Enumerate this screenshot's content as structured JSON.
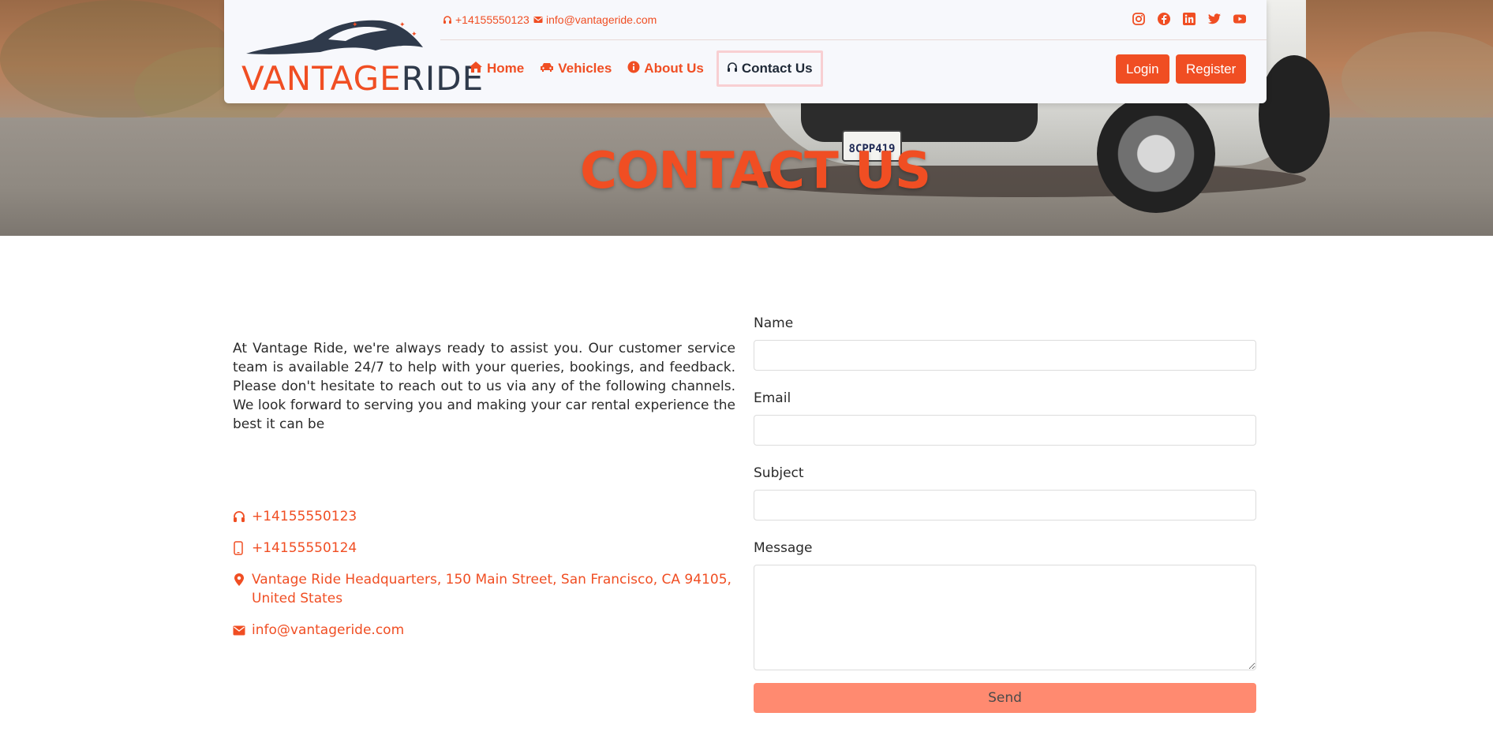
{
  "brand": {
    "part1": "VANTAGE",
    "part2": "RIDE"
  },
  "topbar": {
    "phone": "+14155550123",
    "email": "info@vantageride.com",
    "socials": [
      "instagram-icon",
      "facebook-icon",
      "linkedin-icon",
      "twitter-icon",
      "youtube-icon"
    ]
  },
  "nav": {
    "items": [
      {
        "label": "Home",
        "icon": "home-icon"
      },
      {
        "label": "Vehicles",
        "icon": "car-icon"
      },
      {
        "label": "About Us",
        "icon": "info-icon"
      },
      {
        "label": "Contact Us",
        "icon": "headset-icon",
        "active": true
      }
    ],
    "login": "Login",
    "register": "Register"
  },
  "hero": {
    "title": "CONTACT US",
    "plate": "8CPP419"
  },
  "intro": "At Vantage Ride, we're always ready to assist you. Our customer service team is available 24/7 to help with your queries, bookings, and feedback. Please don't hesitate to reach out to us via any of the following channels. We look forward to serving you and making your car rental experience the best it can be",
  "contacts": [
    {
      "icon": "headset-icon",
      "text": "+14155550123"
    },
    {
      "icon": "mobile-icon",
      "text": "+14155550124"
    },
    {
      "icon": "location-icon",
      "text": "Vantage Ride Headquarters, 150 Main Street, San Francisco, CA 94105, United States"
    },
    {
      "icon": "mail-icon",
      "text": "info@vantageride.com"
    }
  ],
  "form": {
    "name_label": "Name",
    "email_label": "Email",
    "subject_label": "Subject",
    "message_label": "Message",
    "name_value": "",
    "email_value": "",
    "subject_value": "",
    "message_value": "",
    "send": "Send"
  },
  "colors": {
    "accent": "#f04e23",
    "dark": "#2f3a4b",
    "send_button": "#ff8a70",
    "active_border": "#f8cfd2"
  }
}
